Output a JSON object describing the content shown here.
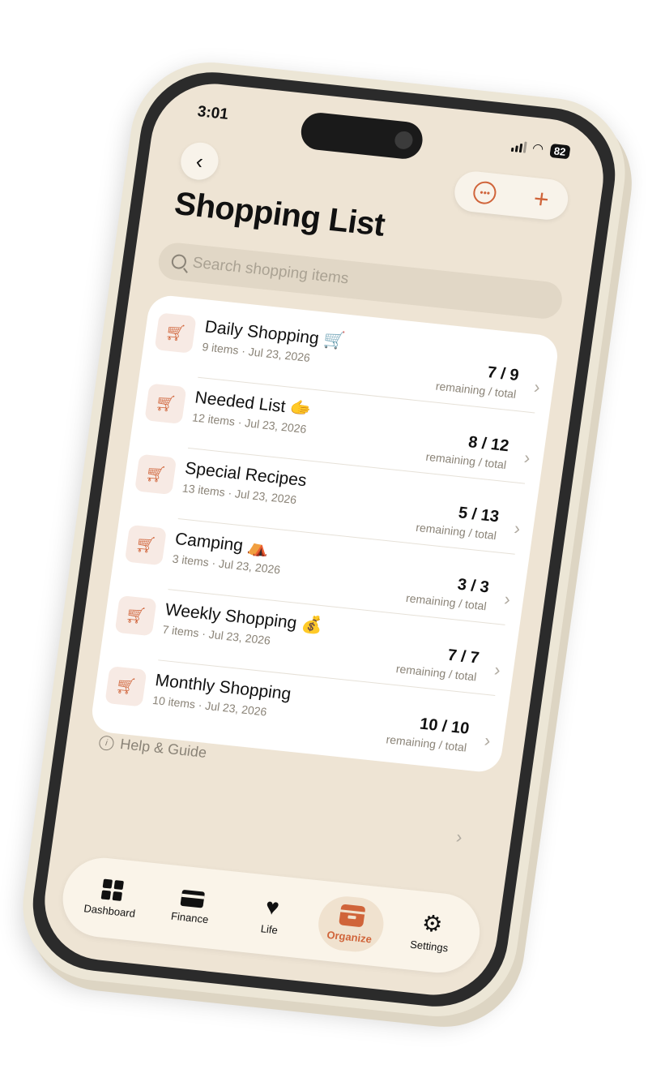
{
  "status": {
    "time": "3:01",
    "battery": "82"
  },
  "header": {
    "title": "Shopping List"
  },
  "search": {
    "placeholder": "Search shopping items"
  },
  "lists": [
    {
      "name": "Daily Shopping 🛒",
      "meta": "9 items · Jul 23, 2026",
      "count": "7 / 9",
      "count_label": "remaining / total"
    },
    {
      "name": "Needed List 🫱",
      "meta": "12 items · Jul 23, 2026",
      "count": "8 / 12",
      "count_label": "remaining / total"
    },
    {
      "name": "Special Recipes",
      "meta": "13 items · Jul 23, 2026",
      "count": "5 / 13",
      "count_label": "remaining / total"
    },
    {
      "name": "Camping ⛺",
      "meta": "3 items · Jul 23, 2026",
      "count": "3 / 3",
      "count_label": "remaining / total"
    },
    {
      "name": "Weekly Shopping 💰",
      "meta": "7 items · Jul 23, 2026",
      "count": "7 / 7",
      "count_label": "remaining / total"
    },
    {
      "name": "Monthly Shopping",
      "meta": "10 items · Jul 23, 2026",
      "count": "10 / 10",
      "count_label": "remaining / total"
    }
  ],
  "help": {
    "label": "Help & Guide"
  },
  "tabbar": {
    "dashboard": "Dashboard",
    "finance": "Finance",
    "life": "Life",
    "organize": "Organize",
    "settings": "Settings",
    "active": "Organize"
  },
  "colors": {
    "accent": "#d0643a",
    "background": "#eee4d4",
    "card": "#ffffff"
  }
}
